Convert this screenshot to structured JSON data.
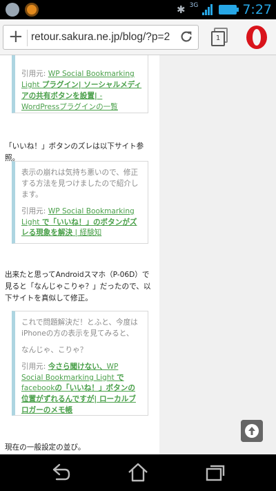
{
  "status_bar": {
    "left_icons": [
      "speaker-icon",
      "app-icon"
    ],
    "network": "3G",
    "time": "7:27"
  },
  "browser": {
    "url": "retour.sakura.ne.jp/blog/?p=2",
    "tab_count": "1"
  },
  "article": {
    "quote1": {
      "source_prefix": "引用元: ",
      "source_link_line1": "WP Social Bookmarking Light ",
      "source_link_bold": "プラグイン| ソーシャルメディアの共有ボタンを設置| ",
      "source_link_tail": "- WordPressプラグインの一覧"
    },
    "para1": "「いいね！」ボタンのズレは以下サイト参照。",
    "quote2": {
      "text": "表示の崩れは気持ち悪いので、修正する方法を見つけましたので紹介します。",
      "source_prefix": "引用元: ",
      "source_link_plain": "WP Social Bookmarking Light ",
      "source_link_bold": "で「いいね！」のボタンがズレる現象を解決",
      "source_link_tail": " | 経験知"
    },
    "para2": "出来たと思ってAndroidスマホ（P-06D）で見ると「なんじゃこりゃ？」だったので、以下サイトを真似して修正。",
    "quote3": {
      "text1": "これで問題解決だ！とふと、今度はiPhoneの方の表示を見てみると、",
      "text2": "なんじゃ、こりゃ？",
      "source_prefix": "引用元: ",
      "source_link_bold1": "今さら聞けない、",
      "source_link_plain": "WP Social Bookmarking Light ",
      "source_link_bold2": "で",
      "source_link_plain2": "facebook",
      "source_link_bold3": "の「いいね！」ボタンの位置がずれるんですが| ローカルブロガーのメモ帳"
    },
    "para3": "現在の一般設定の並び。"
  },
  "nav": {
    "back": "back-icon",
    "home": "home-icon",
    "recent": "recent-apps-icon"
  }
}
